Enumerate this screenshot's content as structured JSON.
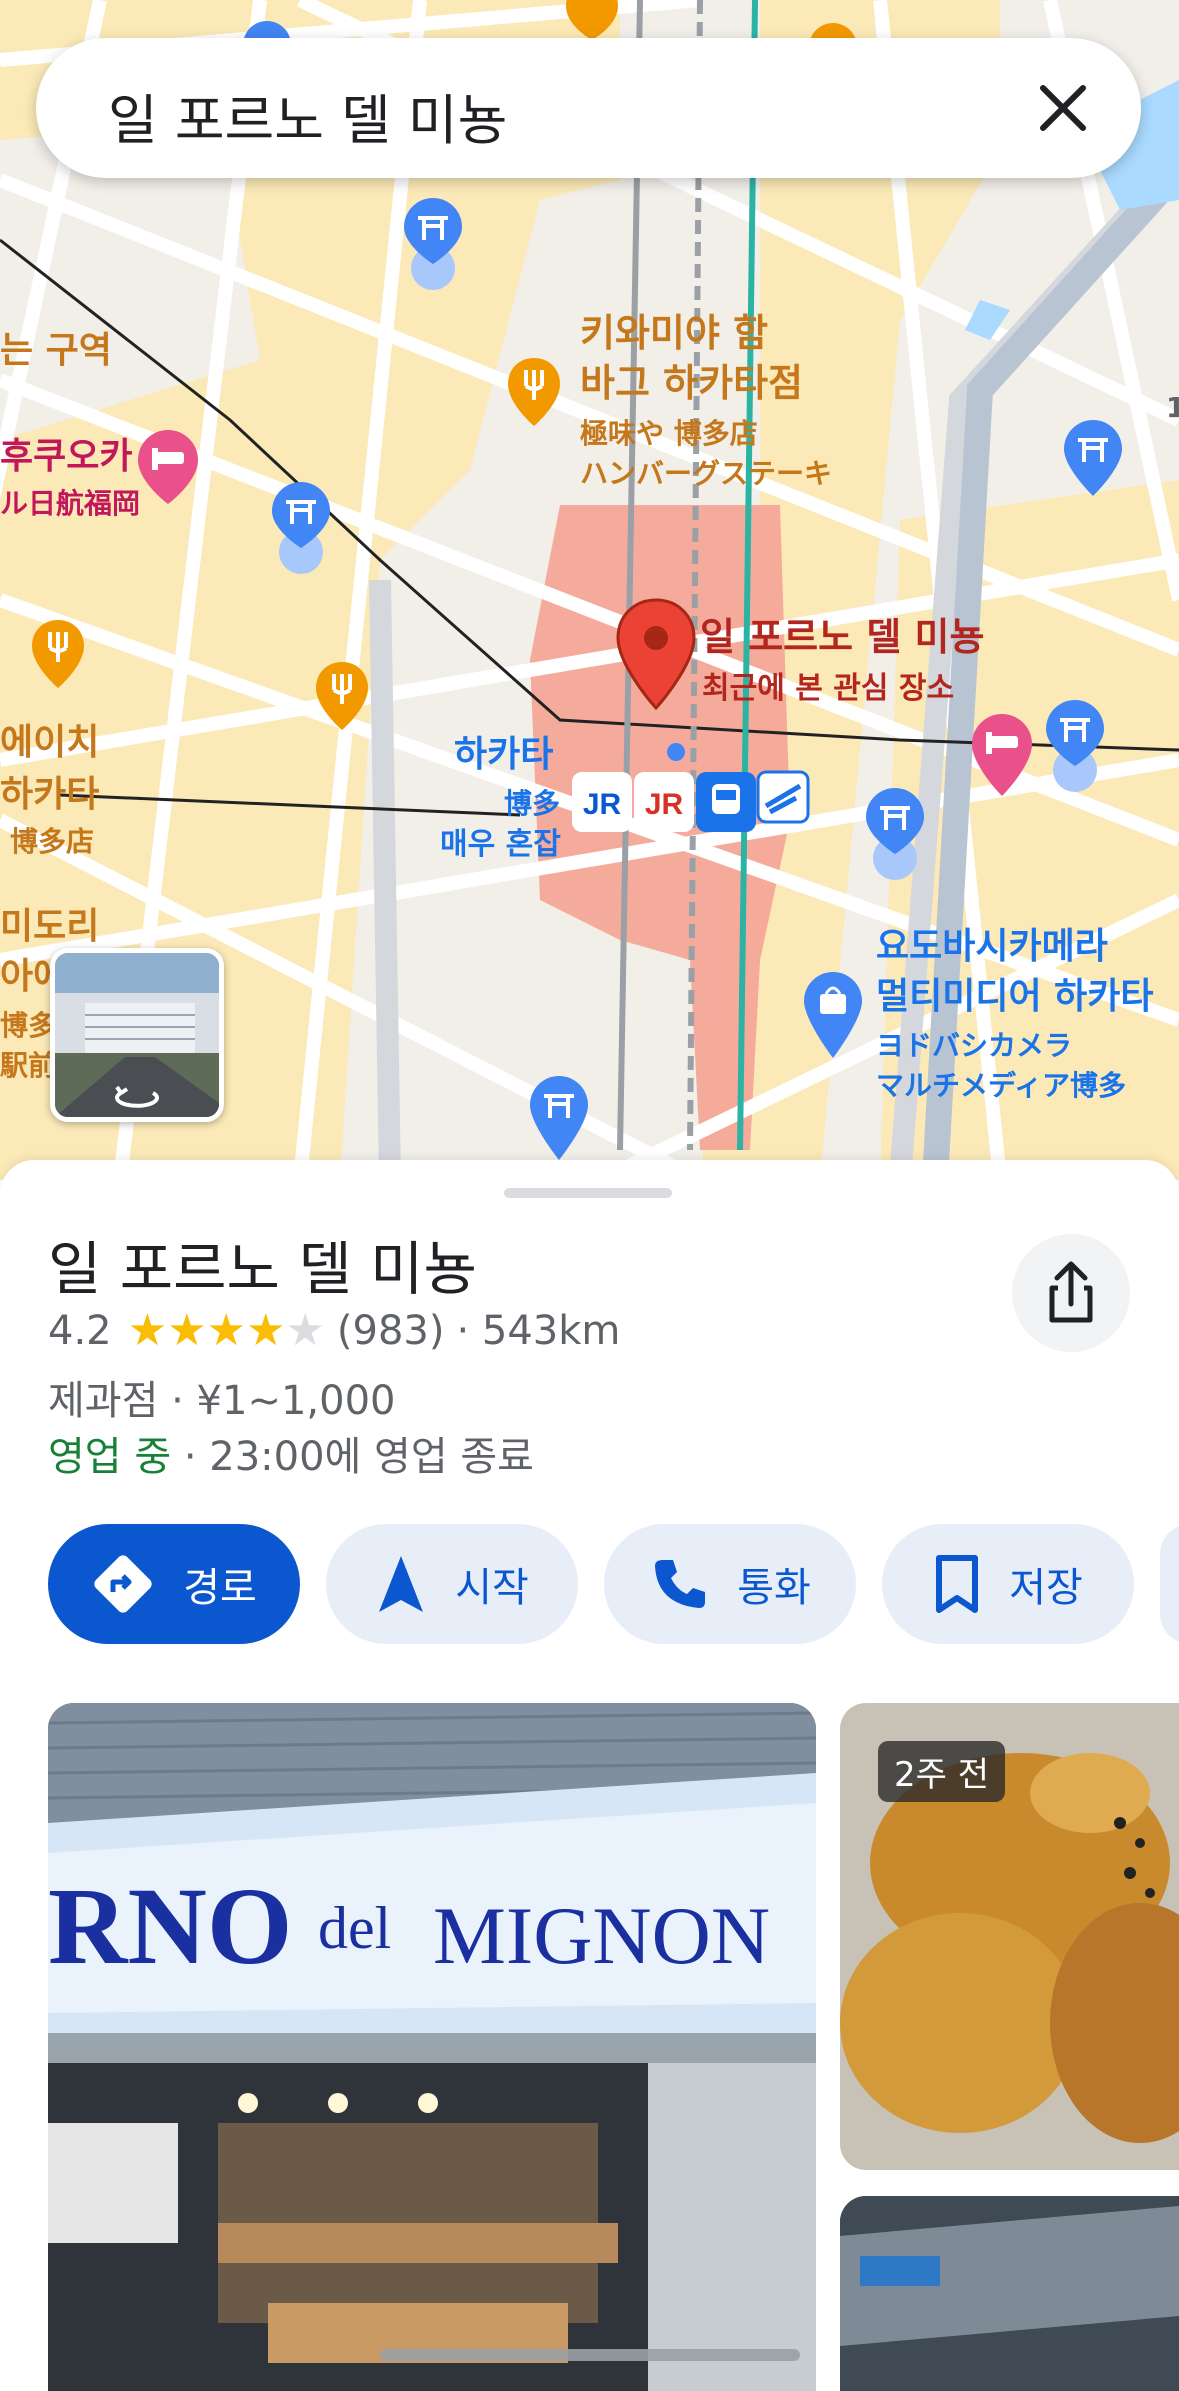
{
  "search": {
    "query": "일 포르노 델 미뇽"
  },
  "map_labels": {
    "district_suffix": "는 구역",
    "kiwamiya_ko_1": "키와미야 함",
    "kiwamiya_ko_2": "바그 하카타점",
    "kiwamiya_ja_1": "極味や 博多店",
    "kiwamiya_ja_2": "ハンバーグステーキ",
    "hotel_left_ko": "후쿠오카",
    "hotel_left_ja": "ル日航福岡",
    "place_pin_name": "일 포르노 델 미뇽",
    "place_pin_sub": "최근에 본 관심 장소",
    "hakata_ko": "하카타",
    "hakata_ja": "博多",
    "hakata_busy": "매우 혼잡",
    "left_1": "에이치",
    "left_2": "하카타",
    "left_3": "博多店",
    "left_4": "미도리",
    "left_5": "아에",
    "left_6": "博多",
    "left_7": "駅前",
    "yodobashi_ko_1": "요도바시카메라",
    "yodobashi_ko_2": "멀티미디어 하카타",
    "yodobashi_ja_1": "ヨドバシカメラ",
    "yodobashi_ja_2": "マルチメディア博多",
    "edge_number": "1"
  },
  "place": {
    "title": "일 포르노 델 미뇽",
    "rating": "4.2",
    "stars_filled": 4,
    "reviews": "(983)",
    "distance": "· 543km",
    "category_price": "제과점 · ¥1~1,000",
    "open_status": "영업 중",
    "hours": " · 23:00에 영업 종료"
  },
  "actions": {
    "directions": "경로",
    "start": "시작",
    "call": "통화",
    "save": "저장"
  },
  "photos": {
    "side_badge": "2주 전",
    "sign_text_1": "RNO",
    "sign_text_2": "del",
    "sign_text_3": "MIGNON"
  }
}
